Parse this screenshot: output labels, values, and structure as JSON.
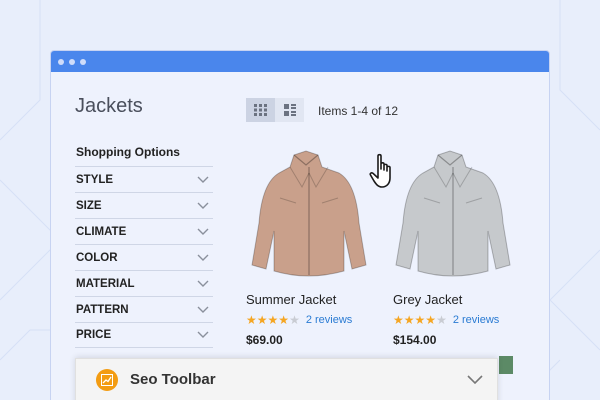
{
  "page": {
    "category_title": "Jackets",
    "shopping_options_title": "Shopping Options",
    "items_count": "Items 1-4 of 12"
  },
  "filters": [
    {
      "label": "STYLE"
    },
    {
      "label": "SIZE"
    },
    {
      "label": "CLIMATE"
    },
    {
      "label": "COLOR"
    },
    {
      "label": "MATERIAL"
    },
    {
      "label": "PATTERN"
    },
    {
      "label": "PRICE"
    }
  ],
  "view_modes": [
    {
      "name": "grid-view",
      "icon": "grid-icon",
      "active": true
    },
    {
      "name": "list-view",
      "icon": "list-icon",
      "active": false
    }
  ],
  "products": [
    {
      "name": "Summer Jacket",
      "rating": 4,
      "max_rating": 5,
      "reviews": "2 reviews",
      "price": "$69.00",
      "color": "#c9a08b"
    },
    {
      "name": "Grey  Jacket",
      "rating": 4,
      "max_rating": 5,
      "reviews": "2 reviews",
      "price": "$154.00",
      "color": "#c6c9cc"
    }
  ],
  "seo_toolbar": {
    "title": "Seo Toolbar",
    "icon": "chart-icon",
    "expanded": false
  },
  "colors": {
    "accent": "#4a86ec",
    "star": "#f5a623",
    "link": "#2a7bd3",
    "seo_icon": "#f39c12"
  }
}
